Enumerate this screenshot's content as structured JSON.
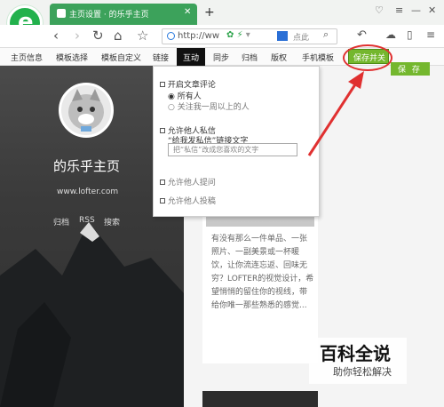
{
  "browser": {
    "tab_title": "主页设置 · 的乐乎主页",
    "logo_letter": "e",
    "url": "http://ww",
    "search": "点此"
  },
  "menu": [
    "主页信息",
    "模板选择",
    "模板自定义",
    "链接",
    "互动",
    "同步",
    "归档",
    "版权",
    "手机模板"
  ],
  "active_menu": "互动",
  "save_close_label": "保存并关",
  "save_label": "保 存",
  "sidebar": {
    "title": "的乐乎主页",
    "url": "www.lofter.com",
    "links": [
      "归档",
      "RSS",
      "搜索"
    ]
  },
  "dropdown": {
    "comment_header": "开启文章评论",
    "comment_options": [
      "所有人",
      "关注我一周以上的人"
    ],
    "private_msg": "允许他人私信",
    "link_text_label": "“给我发私信”链接文字",
    "input_placeholder": "把“私信”改成您喜欢的文字",
    "mention": "允许他人提问",
    "contribute": "允许他人投稿"
  },
  "card_text": "有没有那么一件单品、一张照片、一副美景或一杯暖饮，让你流连忘返、回味无穷？LOFTER的视觉设计，希望悄悄的留住你的视线，带给你唯一那些熟悉的感觉...",
  "watermark": {
    "line1": "百科全说",
    "line2": "助你轻松解决"
  },
  "colors": {
    "tab_green": "#3ca25b",
    "save_green": "#74b72e",
    "annotation_red": "#e03030"
  }
}
